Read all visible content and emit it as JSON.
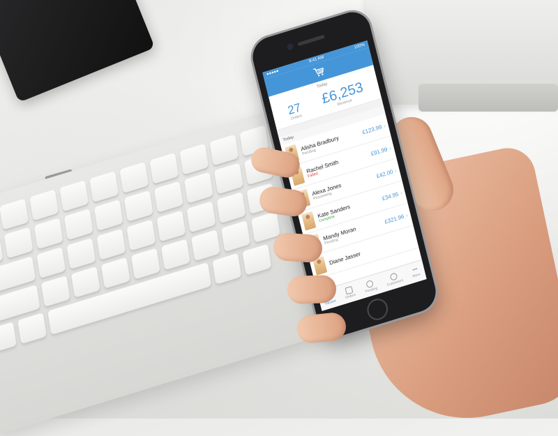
{
  "status_bar": {
    "time": "9:41 AM",
    "battery": "100%"
  },
  "navbar": {
    "icon": "cart-icon"
  },
  "summary": {
    "period": "Today",
    "orders_count": "27",
    "orders_label": "Orders",
    "revenue_value": "£6,253",
    "revenue_label": "Revenue"
  },
  "list": {
    "section_title": "Today",
    "orders": [
      {
        "name": "Alisha Bradbury",
        "status": "Pending",
        "status_type": "pending",
        "amount": "£123.99"
      },
      {
        "name": "Rachel Smith",
        "status": "Failed",
        "status_type": "failed",
        "amount": "£91.99"
      },
      {
        "name": "Alexa Jones",
        "status": "Processing",
        "status_type": "processing",
        "amount": "£42.00"
      },
      {
        "name": "Kate Sanders",
        "status": "Complete",
        "status_type": "complete",
        "amount": "£34.95"
      },
      {
        "name": "Mandy Moran",
        "status": "Pending",
        "status_type": "pending",
        "amount": "£321.96"
      },
      {
        "name": "Diane Jasser",
        "status": "",
        "status_type": "pending",
        "amount": ""
      }
    ]
  },
  "tabbar": {
    "tabs": [
      {
        "label": "Recent",
        "active": true
      },
      {
        "label": "Orders",
        "active": false
      },
      {
        "label": "Pending",
        "active": false
      },
      {
        "label": "Customers",
        "active": false
      },
      {
        "label": "More",
        "active": false
      }
    ]
  },
  "colors": {
    "accent": "#4596d8",
    "failed": "#e0342f",
    "complete": "#3bb24b"
  }
}
